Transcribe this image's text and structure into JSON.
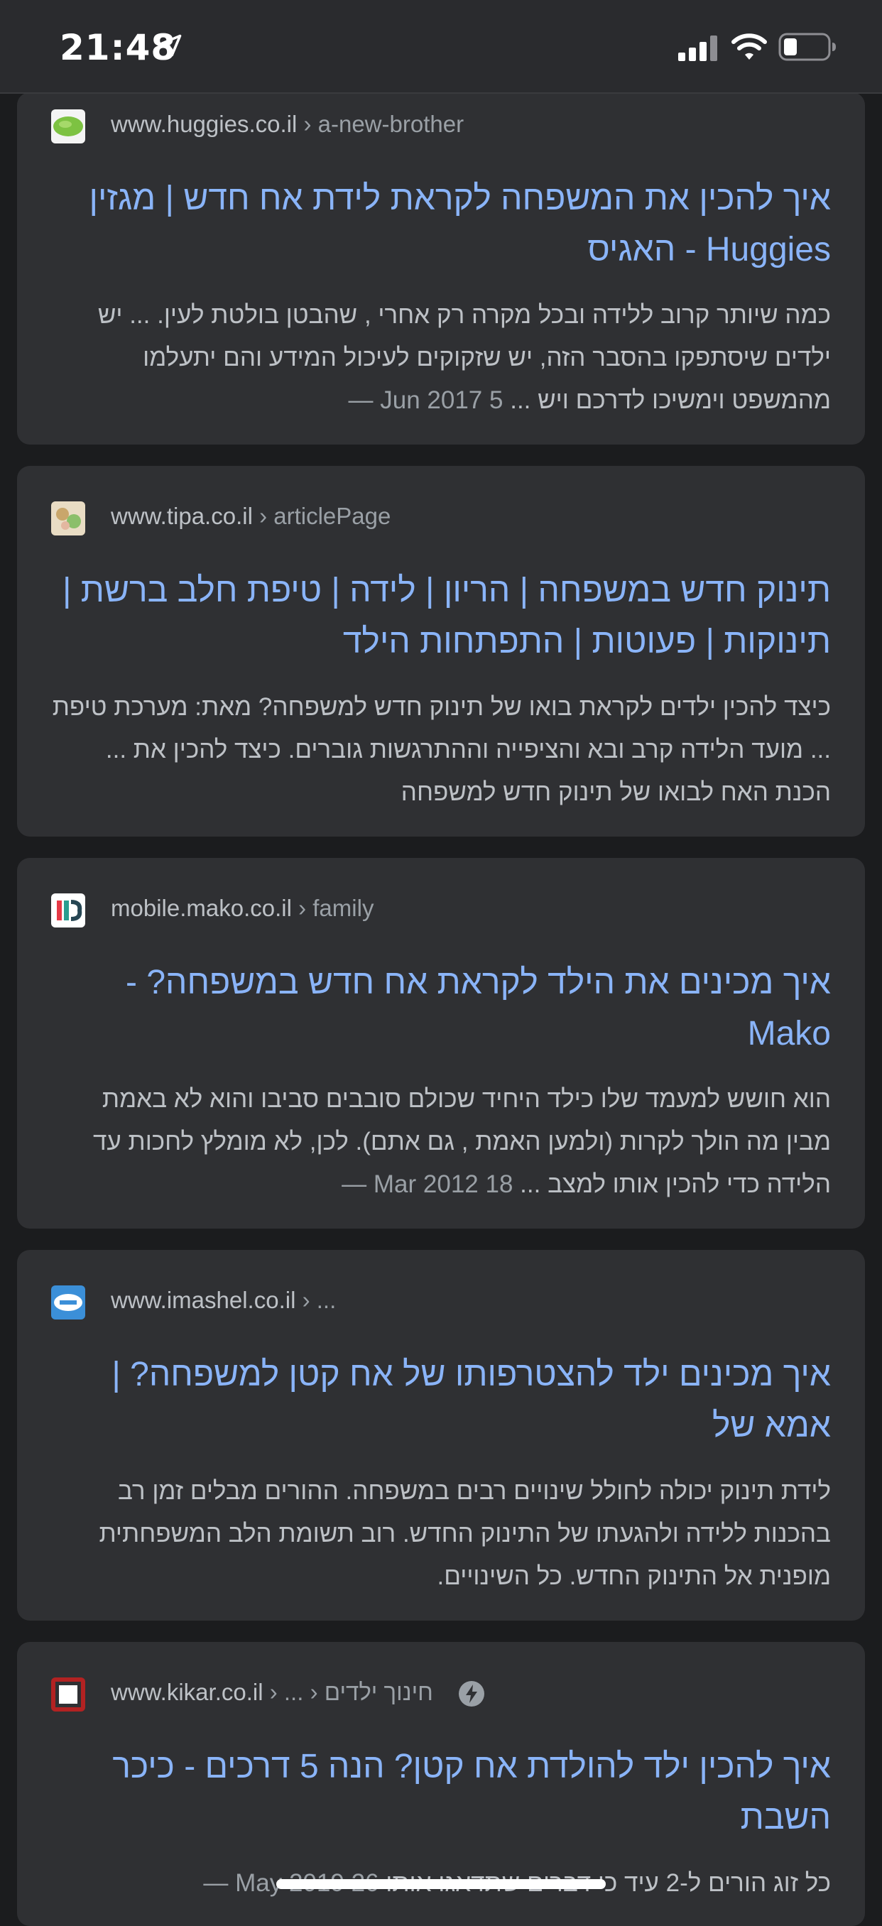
{
  "status": {
    "time": "21:48"
  },
  "results": [
    {
      "site": "www.huggies.co.il",
      "path": "› a-new-brother",
      "title": "איך להכין את המשפחה לקראת לידת אח חדש | מגזין Huggies - האגיס",
      "date": "5 Jun 2017 —",
      "snippet": "כמה שיותר קרוב ללידה ובכל מקרה רק אחרי , שהבטן בולטת לעין. ... יש ילדים שיסתפקו בהסבר הזה, יש שזקוקים לעיכול המידע והם יתעלמו מהמשפט וימשיכו לדרכם ויש ..."
    },
    {
      "site": "www.tipa.co.il",
      "path": "› articlePage",
      "title": "תינוק חדש במשפחה | הריון | לידה | טיפת חלב ברשת | תינוקות | פעוטות | התפתחות הילד",
      "date": "",
      "snippet": "כיצד להכין ילדים לקראת בואו של תינוק חדש למשפחה? מאת: מערכת טיפת ... מועד הלידה קרב ובא והציפייה וההתרגשות גוברים. כיצד להכין את ... הכנת האח לבואו של תינוק חדש למשפחה"
    },
    {
      "site": "mobile.mako.co.il",
      "path": "› family",
      "title": "איך מכינים את הילד לקראת אח חדש במשפחה? - Mako",
      "date": "18 Mar 2012 —",
      "snippet": "הוא חושש למעמד שלו כילד היחיד שכולם סובבים סביבו והוא לא באמת מבין מה הולך לקרות (ולמען האמת , גם אתם). לכן, לא מומלץ לחכות עד הלידה כדי להכין אותו למצב ..."
    },
    {
      "site": "www.imashel.co.il",
      "path": "› ...",
      "title": "איך מכינים ילד להצטרפותו של אח קטן למשפחה? | אמא של",
      "date": "",
      "snippet": "לידת תינוק יכולה לחולל שינויים רבים במשפחה. ההורים מבלים זמן רב בהכנות ללידה ולהגעתו של התינוק החדש. רוב תשומת הלב המשפחתית מופנית אל התינוק החדש. כל השינויים."
    },
    {
      "site": "www.kikar.co.il",
      "path": "› ... › חינוך ילדים",
      "title": "איך להכין ילד להולדת אח קטן? הנה 5 דרכים - כיכר השבת",
      "date": "26 May 2019 —",
      "snippet": "כל זוג הורים ל-2 עיד כי דברים שתדאגו אותו"
    }
  ],
  "colors": {
    "background": "#1b1c1e",
    "card": "#2f3033",
    "title_link": "#8ab4f8",
    "text": "#bdc1c6"
  },
  "icons": [
    "location-arrow-icon",
    "cellular-signal-icon",
    "wifi-icon",
    "battery-icon",
    "amp-lightning-icon"
  ]
}
